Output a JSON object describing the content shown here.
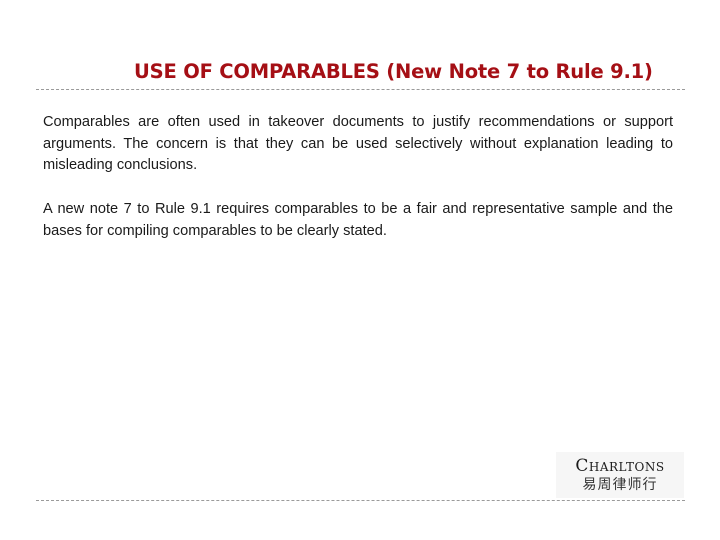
{
  "slide": {
    "title": "USE OF COMPARABLES (New Note 7 to Rule 9.1)",
    "paragraphs": [
      "Comparables are often used in takeover documents to justify recommendations or support arguments.  The concern is that they can be used selectively without explanation leading to misleading conclusions.",
      "A new note 7 to Rule 9.1 requires comparables to be a fair and representative sample and  the bases for compiling comparables to be clearly stated."
    ]
  },
  "logo": {
    "name": "Charltons",
    "chinese_name": "易周律师行"
  },
  "colors": {
    "title": "#a50f15",
    "body_text": "#1a1a1a",
    "rule": "#9a9a9a"
  }
}
